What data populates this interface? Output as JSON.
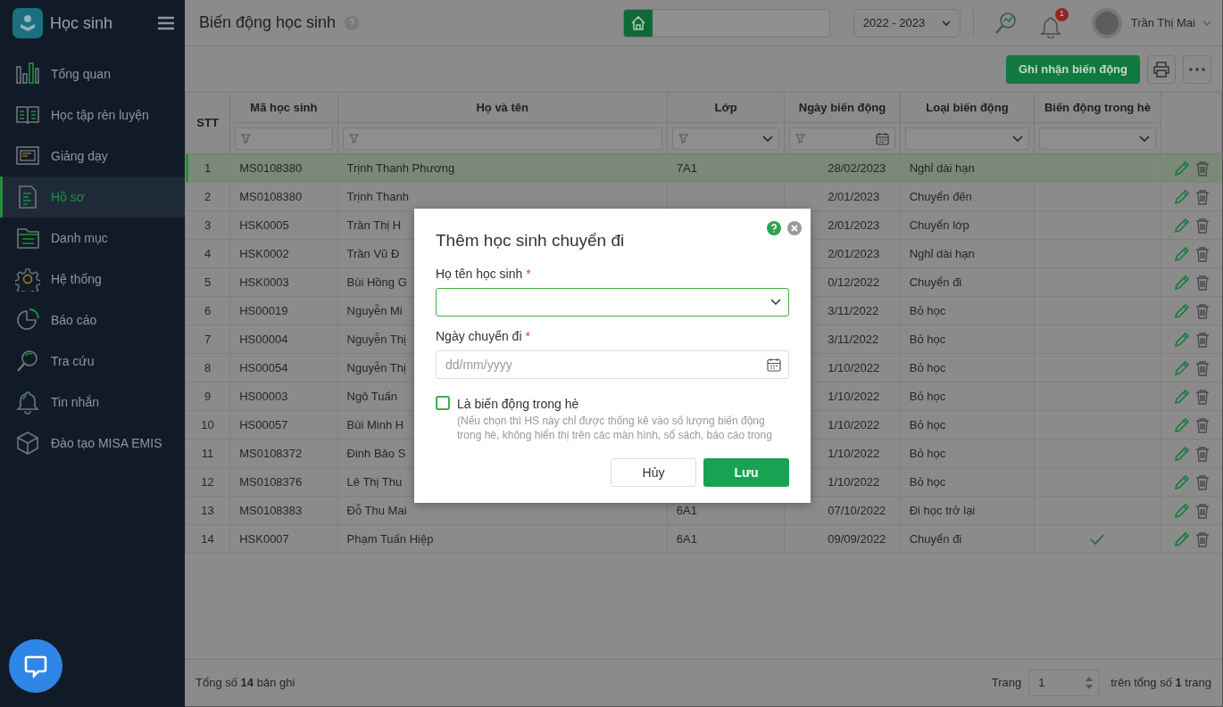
{
  "sidebar": {
    "app_title": "Học sinh",
    "items": [
      {
        "kind": "chart",
        "label": "Tổng quan",
        "selected": false
      },
      {
        "kind": "book",
        "label": "Học tập rèn luyện",
        "selected": false
      },
      {
        "kind": "board",
        "label": "Giảng dạy",
        "selected": false
      },
      {
        "kind": "document",
        "label": "Hồ sơ",
        "selected": true
      },
      {
        "kind": "folder",
        "label": "Danh mục",
        "selected": false
      },
      {
        "kind": "gear",
        "label": "Hệ thống",
        "selected": false
      },
      {
        "kind": "pie",
        "label": "Báo cáo",
        "selected": false
      },
      {
        "kind": "search",
        "label": "Tra cứu",
        "selected": false
      },
      {
        "kind": "bell",
        "label": "Tin nhắn",
        "selected": false
      },
      {
        "kind": "cube",
        "label": "Đào tạo MISA EMIS",
        "selected": false
      }
    ]
  },
  "header": {
    "title": "Biến động học sinh",
    "school_year": "2022 - 2023",
    "notification_count": "1",
    "user_name": "Trần Thị Mai"
  },
  "toolbar": {
    "record_button": "Ghi nhận biến động"
  },
  "table": {
    "columns": [
      {
        "label": "STT",
        "kind": "none"
      },
      {
        "label": "Mã học sinh",
        "kind": "text"
      },
      {
        "label": "Họ và tên",
        "kind": "text"
      },
      {
        "label": "Lớp",
        "kind": "select_text"
      },
      {
        "label": "Ngày biến động",
        "kind": "date"
      },
      {
        "label": "Loại biến động",
        "kind": "select"
      },
      {
        "label": "Biến động trong hè",
        "kind": "select"
      }
    ],
    "rows": [
      {
        "stt": "1",
        "code": "MS0108380",
        "name": "Trịnh Thanh Phương",
        "class": "7A1",
        "date": "28/02/2023",
        "type": "Nghỉ dài hạn",
        "summer": false,
        "selected": true
      },
      {
        "stt": "2",
        "code": "MS0108380",
        "name": "Trịnh Thanh",
        "date": "2/01/2023",
        "type": "Chuyển đến",
        "summer": false,
        "selected": false
      },
      {
        "stt": "3",
        "code": "HSK0005",
        "name": "Trần Thị H",
        "date": "2/01/2023",
        "type": "Chuyển lớp",
        "summer": false,
        "selected": false
      },
      {
        "stt": "4",
        "code": "HSK0002",
        "name": "Trần Vũ Đ",
        "date": "2/01/2023",
        "type": "Nghỉ dài hạn",
        "summer": false,
        "selected": false
      },
      {
        "stt": "5",
        "code": "HSK0003",
        "name": "Bùi Hồng G",
        "date": "0/12/2022",
        "type": "Chuyển đi",
        "summer": false,
        "selected": false
      },
      {
        "stt": "6",
        "code": "HS00019",
        "name": "Nguyễn Mi",
        "date": "3/11/2022",
        "type": "Bỏ học",
        "summer": false,
        "selected": false
      },
      {
        "stt": "7",
        "code": "HS00004",
        "name": "Nguyễn Thị",
        "date": "3/11/2022",
        "type": "Bỏ học",
        "summer": false,
        "selected": false
      },
      {
        "stt": "8",
        "code": "HS00054",
        "name": "Nguyễn Thị",
        "date": "1/10/2022",
        "type": "Bỏ học",
        "summer": false,
        "selected": false
      },
      {
        "stt": "9",
        "code": "HS00003",
        "name": "Ngô Tuấn",
        "date": "1/10/2022",
        "type": "Bỏ học",
        "summer": false,
        "selected": false
      },
      {
        "stt": "10",
        "code": "HS00057",
        "name": "Bùi Minh H",
        "date": "1/10/2022",
        "type": "Bỏ học",
        "summer": false,
        "selected": false
      },
      {
        "stt": "11",
        "code": "MS0108372",
        "name": "Đinh Bảo S",
        "date": "1/10/2022",
        "type": "Bỏ học",
        "summer": false,
        "selected": false
      },
      {
        "stt": "12",
        "code": "MS0108376",
        "name": "Lê Thị Thu",
        "date": "1/10/2022",
        "type": "Bỏ học",
        "summer": false,
        "selected": false
      },
      {
        "stt": "13",
        "code": "MS0108383",
        "name": "Đỗ Thu Mai",
        "class": "6A1",
        "date": "07/10/2022",
        "type": "Đi học trở lại",
        "summer": false,
        "selected": false
      },
      {
        "stt": "14",
        "code": "HSK0007",
        "name": "Phạm Tuấn Hiệp",
        "class": "6A1",
        "date": "09/09/2022",
        "type": "Chuyển đi",
        "summer": true,
        "selected": false
      }
    ]
  },
  "footer": {
    "total": "Tổng số **14** bản ghi",
    "page_label": "Trang",
    "page_value": "1",
    "page_total": "trên tổng số **1** trang"
  },
  "modal": {
    "title": "Thêm học sinh chuyển đi",
    "fields": [
      {
        "kind": "select",
        "label": "Họ tên học sinh",
        "required_mark": "*",
        "focused": true
      },
      {
        "kind": "date",
        "label": "Ngày chuyển đi",
        "required_mark": "*",
        "placeholder": "dd/mm/yyyy",
        "focused": false
      }
    ],
    "summer_option": {
      "label": "Là biến động trong hè",
      "checked": false,
      "note": "(Nếu chọn thì HS này chỉ được thống kê vào số lượng biến động trong hè, không hiển thị trên các màn hình, sổ sách, báo cáo trong"
    },
    "buttons": [
      {
        "kind": "cancel",
        "label": "Hủy"
      },
      {
        "kind": "save",
        "label": "Lưu"
      }
    ]
  }
}
